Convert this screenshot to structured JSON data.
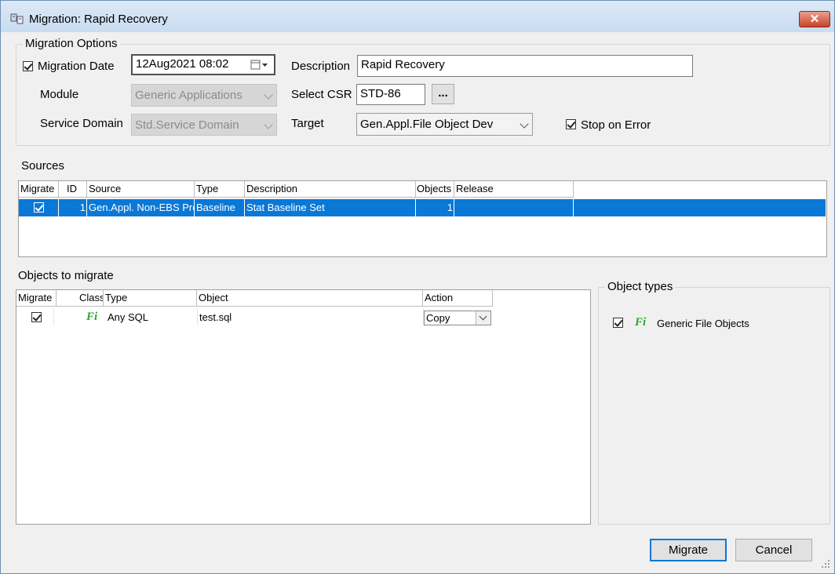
{
  "window": {
    "title": "Migration: Rapid Recovery",
    "close_glyph": "✕"
  },
  "migration_options": {
    "legend": "Migration Options",
    "migration_date_label": "Migration Date",
    "migration_date_checked": true,
    "migration_date_value": "12Aug2021 08:02",
    "description_label": "Description",
    "description_value": "Rapid Recovery",
    "module_label": "Module",
    "module_value": "Generic Applications",
    "select_csr_label": "Select CSR",
    "select_csr_value": "STD-86",
    "browse_label": "...",
    "service_domain_label": "Service Domain",
    "service_domain_value": "Std.Service Domain",
    "target_label": "Target",
    "target_value": "Gen.Appl.File Object Dev",
    "stop_on_error_label": "Stop on Error",
    "stop_on_error_checked": true
  },
  "sources": {
    "title": "Sources",
    "columns": [
      "Migrate",
      "ID",
      "Source",
      "Type",
      "Description",
      "Objects",
      "Release"
    ],
    "rows": [
      {
        "migrate": true,
        "id": "1",
        "source": "Gen.Appl. Non-EBS Pro",
        "type": "Baseline",
        "description": "Stat Baseline Set",
        "objects": "1",
        "release": ""
      }
    ]
  },
  "objects": {
    "title": "Objects to migrate",
    "columns": [
      "Migrate",
      "Class",
      "Type",
      "Object",
      "Action"
    ],
    "rows": [
      {
        "migrate": true,
        "class_icon": "Fi",
        "type": "Any SQL",
        "object": "test.sql",
        "action": "Copy"
      }
    ]
  },
  "object_types": {
    "title": "Object types",
    "items": [
      {
        "checked": true,
        "icon": "Fi",
        "label": "Generic File Objects"
      }
    ]
  },
  "buttons": {
    "migrate": "Migrate",
    "cancel": "Cancel"
  },
  "colors": {
    "selection": "#0a78d7",
    "file_icon": "#2ea52e",
    "close": "#c8432a"
  }
}
